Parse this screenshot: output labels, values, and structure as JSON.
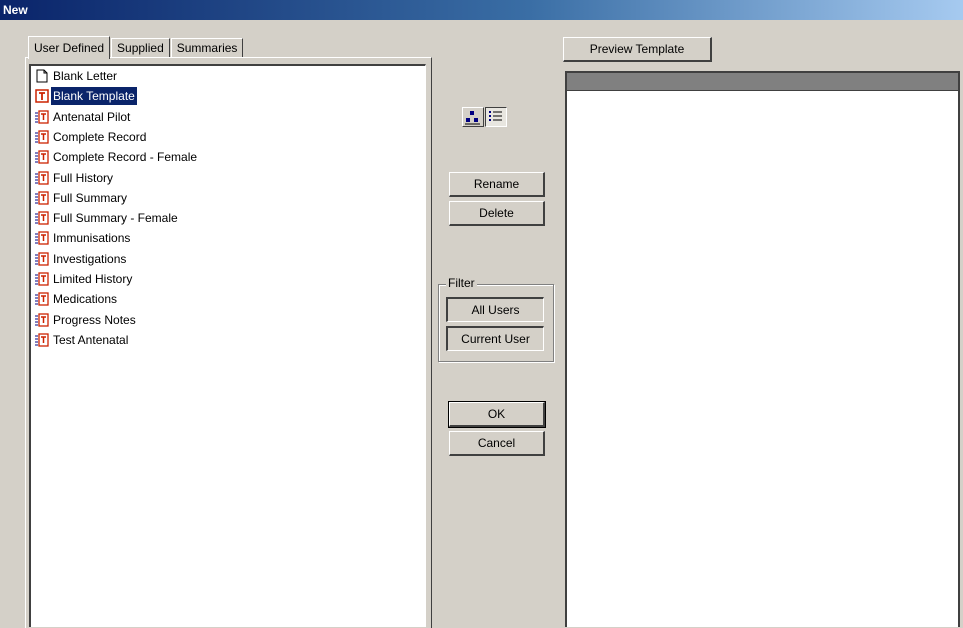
{
  "window": {
    "title": "New"
  },
  "tabs": [
    {
      "label": "User Defined",
      "active": true
    },
    {
      "label": "Supplied",
      "active": false
    },
    {
      "label": "Summaries",
      "active": false
    }
  ],
  "templates": [
    {
      "label": "Blank Letter",
      "icon": "blank-document-icon"
    },
    {
      "label": "Blank Template",
      "icon": "template-t-icon",
      "selected": true
    },
    {
      "label": "Antenatal Pilot",
      "icon": "template-stack-icon"
    },
    {
      "label": "Complete Record",
      "icon": "template-stack-icon"
    },
    {
      "label": "Complete Record - Female",
      "icon": "template-stack-icon"
    },
    {
      "label": "Full History",
      "icon": "template-stack-icon"
    },
    {
      "label": "Full Summary",
      "icon": "template-stack-icon"
    },
    {
      "label": "Full Summary - Female",
      "icon": "template-stack-icon"
    },
    {
      "label": "Immunisations",
      "icon": "template-stack-icon"
    },
    {
      "label": "Investigations",
      "icon": "template-stack-icon"
    },
    {
      "label": "Limited History",
      "icon": "template-stack-icon"
    },
    {
      "label": "Medications",
      "icon": "template-stack-icon"
    },
    {
      "label": "Progress Notes",
      "icon": "template-stack-icon"
    },
    {
      "label": "Test Antenatal",
      "icon": "template-stack-icon"
    }
  ],
  "view_buttons": [
    {
      "icon": "large-icons-view-icon",
      "pressed": false
    },
    {
      "icon": "details-list-view-icon",
      "pressed": true
    }
  ],
  "actions": {
    "rename": "Rename",
    "delete": "Delete"
  },
  "filter": {
    "label": "Filter",
    "all_users": "All Users",
    "current_user": "Current User"
  },
  "dialog": {
    "ok": "OK",
    "cancel": "Cancel"
  },
  "preview": {
    "button_label": "Preview Template"
  },
  "colors": {
    "selection": "#0a246a",
    "face": "#d4d0c8",
    "template_icon": "#cc2200"
  }
}
